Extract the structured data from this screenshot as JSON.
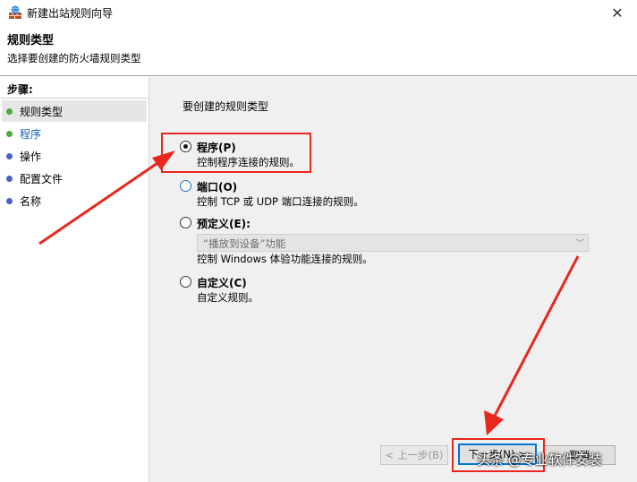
{
  "window": {
    "title": "新建出站规则向导",
    "close_glyph": "✕"
  },
  "header": {
    "title": "规则类型",
    "subtitle": "选择要创建的防火墙规则类型"
  },
  "sidebar": {
    "steps_label": "步骤:",
    "items": [
      {
        "label": "规则类型",
        "dot": "green",
        "state": "current"
      },
      {
        "label": "程序",
        "dot": "green",
        "state": "link"
      },
      {
        "label": "操作",
        "dot": "blue",
        "state": "normal"
      },
      {
        "label": "配置文件",
        "dot": "blue",
        "state": "normal"
      },
      {
        "label": "名称",
        "dot": "blue",
        "state": "normal"
      }
    ]
  },
  "main": {
    "prompt": "要创建的规则类型",
    "options": [
      {
        "label": "程序(P)",
        "desc": "控制程序连接的规则。",
        "selected": true
      },
      {
        "label": "端口(O)",
        "desc": "控制 TCP 或 UDP 端口连接的规则。",
        "selected": false
      },
      {
        "label": "预定义(E):",
        "desc": "控制 Windows 体验功能连接的规则。",
        "selected": false
      },
      {
        "label": "自定义(C)",
        "desc": "自定义规则。",
        "selected": false
      }
    ],
    "predefined_select": {
      "value": "“播放到设备”功能",
      "arrow": "﹀"
    }
  },
  "buttons": {
    "back": "< 上一步(B)",
    "next": "下一步(N) >",
    "cancel": "取消"
  },
  "watermark": "头条 @专业软件安装",
  "colors": {
    "highlight": "#e8281e",
    "accent": "#0078d7",
    "link": "#1a5fb4"
  }
}
